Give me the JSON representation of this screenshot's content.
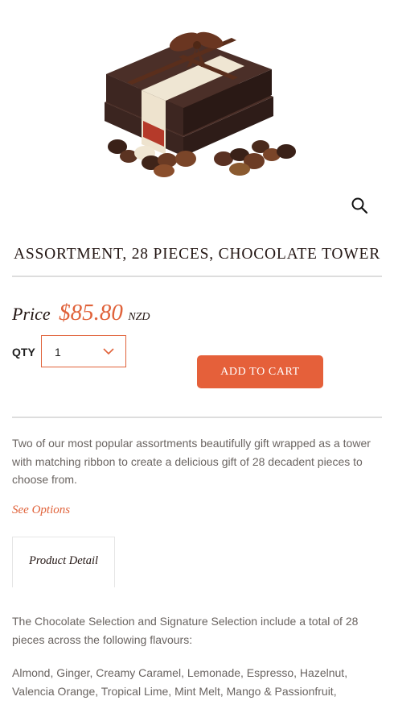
{
  "product": {
    "image_icon": "chocolate-tower-gift-box",
    "title": "ASSORTMENT, 28 PIECES, CHOCOLATE TOWER",
    "price_label": "Price",
    "price": "$85.80",
    "currency": "NZD",
    "qty_label": "QTY",
    "qty_value": "1",
    "add_to_cart": "ADD TO CART",
    "description": "Two of our most popular assortments beautifully gift wrapped as a tower with matching ribbon to create a delicious gift of 28 decadent pieces to choose from.",
    "see_options": "See Options"
  },
  "tabs": [
    {
      "label": "Product Detail"
    }
  ],
  "detail": {
    "paragraph1": "The Chocolate Selection and Signature Selection include a total of 28 pieces across the following flavours:",
    "paragraph2": "Almond, Ginger, Creamy Caramel, Lemonade, Espresso, Hazelnut, Valencia Orange, Tropical Lime, Mint Melt, Mango & Passionfruit,"
  },
  "colors": {
    "accent": "#e0623a",
    "button": "#e5603a",
    "heading": "#231613",
    "body_text": "#6a6461",
    "rule": "#dddddd"
  },
  "icons": {
    "zoom": "magnifier-icon",
    "dropdown": "chevron-down-icon"
  }
}
